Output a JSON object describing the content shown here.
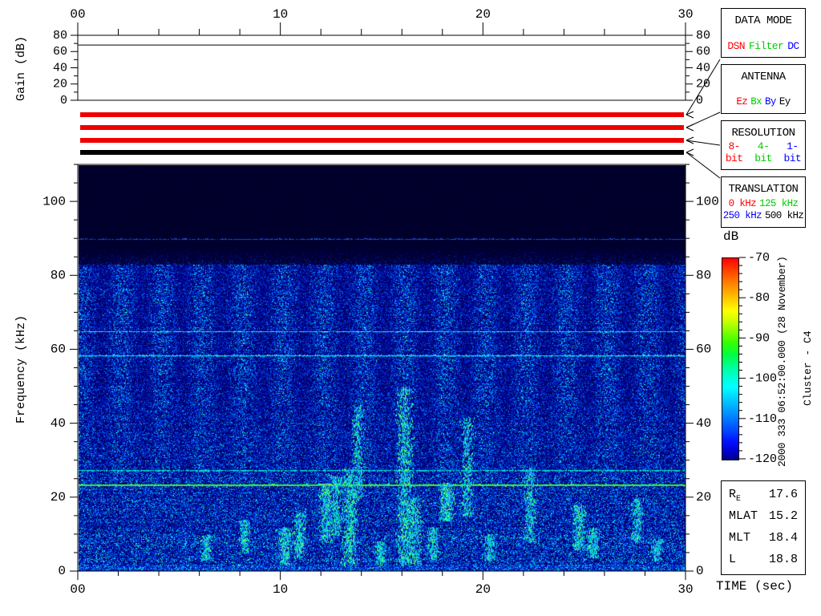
{
  "window": {
    "description": "Cluster C4 WBD plasma wave spectrogram display"
  },
  "gain_panel": {
    "ylabel": "Gain (dB)",
    "yticks": [
      "0",
      "20",
      "40",
      "60",
      "80"
    ],
    "xticks": [
      "00",
      "10",
      "20",
      "30"
    ],
    "gain_line_db": 68
  },
  "spectrogram": {
    "ylabel": "Frequency (kHz)",
    "xlabel": "TIME (sec)",
    "yticks": [
      "0",
      "20",
      "40",
      "60",
      "80",
      "100"
    ],
    "xticks": [
      "00",
      "10",
      "20",
      "30"
    ]
  },
  "colorbar": {
    "label": "dB",
    "ticks": [
      "-70",
      "-80",
      "-90",
      "-100",
      "-110",
      "-120"
    ]
  },
  "status_bars": [
    {
      "name": "data-mode-bar",
      "value": "DSN",
      "color": "#ee0000"
    },
    {
      "name": "antenna-bar",
      "value": "Ez",
      "color": "#ee0000"
    },
    {
      "name": "resolution-bar",
      "value": "8-bit",
      "color": "#ee0000"
    },
    {
      "name": "translation-bar",
      "value": "500 kHz",
      "color": "#000000"
    }
  ],
  "legend_boxes": [
    {
      "id": "data-mode",
      "title": "DATA MODE",
      "rows": [
        [
          {
            "label": "DSN",
            "color": "#ff0000"
          },
          {
            "label": "Filter",
            "color": "#00cc00"
          },
          {
            "label": "DC",
            "color": "#0000ff"
          }
        ]
      ]
    },
    {
      "id": "antenna",
      "title": "ANTENNA",
      "rows": [
        [
          {
            "label": "Ez",
            "color": "#ff0000"
          },
          {
            "label": "Bx",
            "color": "#00cc00"
          },
          {
            "label": "By",
            "color": "#0000ff"
          },
          {
            "label": "Ey",
            "color": "#000000"
          }
        ]
      ]
    },
    {
      "id": "resolution",
      "title": "RESOLUTION",
      "rows": [
        [
          {
            "label": "8-bit",
            "color": "#ff0000"
          },
          {
            "label": "4-bit",
            "color": "#00cc00"
          },
          {
            "label": "1-bit",
            "color": "#0000ff"
          }
        ]
      ]
    },
    {
      "id": "translation",
      "title": "TRANSLATION",
      "rows": [
        [
          {
            "label": "0 kHz",
            "color": "#ff0000"
          },
          {
            "label": "125 kHz",
            "color": "#00cc00"
          }
        ],
        [
          {
            "label": "250 kHz",
            "color": "#0000ff"
          },
          {
            "label": "500 kHz",
            "color": "#000000"
          }
        ]
      ]
    }
  ],
  "side_text": {
    "datetime": "2000 333 06:52:00.000 (28 November)",
    "spacecraft": "Cluster - C4"
  },
  "ephemeris": {
    "rows": [
      {
        "label": "R",
        "sub": "E",
        "value": "17.6"
      },
      {
        "label": "MLAT",
        "sub": "",
        "value": "15.2"
      },
      {
        "label": "MLT",
        "sub": "",
        "value": "18.4"
      },
      {
        "label": "L",
        "sub": "",
        "value": "18.8"
      }
    ]
  },
  "chart_data": [
    {
      "type": "line",
      "title": "Receiver gain vs time",
      "ylabel": "Gain (dB)",
      "xlim_sec": [
        0,
        30
      ],
      "ylim_db": [
        0,
        80
      ],
      "x_major_tick_step_sec": 10,
      "x_minor_tick_step_sec": 2,
      "series": [
        {
          "name": "gain_db",
          "x": [
            0,
            30
          ],
          "values": [
            68,
            68
          ]
        }
      ]
    },
    {
      "type": "heatmap",
      "title": "WBD electric field spectrogram",
      "xlabel": "TIME (sec)",
      "ylabel": "Frequency (kHz)",
      "xlim_sec": [
        0,
        30
      ],
      "ylim_khz": [
        0,
        110
      ],
      "color_scale": {
        "label": "dB",
        "min": -120,
        "max": -70,
        "ticks": [
          -70,
          -80,
          -90,
          -100,
          -110,
          -120
        ]
      },
      "noise_ceiling_khz": 83,
      "vertical_banding_period_sec": 2,
      "horizontal_lines_khz": [
        {
          "freq_khz": 90,
          "appearance": "faint dashed blue",
          "approx_db": -110
        },
        {
          "freq_khz": 65,
          "appearance": "thin cyan",
          "approx_db": -106
        },
        {
          "freq_khz": 58.5,
          "appearance": "cyan",
          "approx_db": -104
        },
        {
          "freq_khz": 27.5,
          "appearance": "cyan dashed",
          "approx_db": -104
        },
        {
          "freq_khz": 23.5,
          "appearance": "bright green solid",
          "approx_db": -95
        }
      ],
      "bursts": [
        {
          "t_sec": 6.3,
          "f_khz": [
            3,
            10
          ],
          "strength": 0.35
        },
        {
          "t_sec": 8.2,
          "f_khz": [
            5,
            14
          ],
          "strength": 0.4
        },
        {
          "t_sec": 10.2,
          "f_khz": [
            2,
            12
          ],
          "strength": 0.55
        },
        {
          "t_sec": 10.9,
          "f_khz": [
            4,
            16
          ],
          "strength": 0.5
        },
        {
          "t_sec": 12.2,
          "f_khz": [
            8,
            24
          ],
          "strength": 0.6
        },
        {
          "t_sec": 12.7,
          "f_khz": [
            10,
            26
          ],
          "strength": 0.55
        },
        {
          "t_sec": 13.4,
          "f_khz": [
            2,
            28
          ],
          "strength": 0.8
        },
        {
          "t_sec": 13.8,
          "f_khz": [
            20,
            45
          ],
          "strength": 0.45
        },
        {
          "t_sec": 14.9,
          "f_khz": [
            2,
            8
          ],
          "strength": 0.4
        },
        {
          "t_sec": 16.1,
          "f_khz": [
            2,
            50
          ],
          "strength": 0.85
        },
        {
          "t_sec": 16.6,
          "f_khz": [
            2,
            20
          ],
          "strength": 0.6
        },
        {
          "t_sec": 17.5,
          "f_khz": [
            3,
            12
          ],
          "strength": 0.45
        },
        {
          "t_sec": 18.2,
          "f_khz": [
            14,
            24
          ],
          "strength": 0.7
        },
        {
          "t_sec": 19.2,
          "f_khz": [
            15,
            42
          ],
          "strength": 0.5
        },
        {
          "t_sec": 20.3,
          "f_khz": [
            3,
            10
          ],
          "strength": 0.35
        },
        {
          "t_sec": 22.3,
          "f_khz": [
            8,
            28
          ],
          "strength": 0.5
        },
        {
          "t_sec": 24.7,
          "f_khz": [
            6,
            18
          ],
          "strength": 0.55
        },
        {
          "t_sec": 25.4,
          "f_khz": [
            4,
            12
          ],
          "strength": 0.45
        },
        {
          "t_sec": 27.6,
          "f_khz": [
            8,
            20
          ],
          "strength": 0.4
        },
        {
          "t_sec": 28.6,
          "f_khz": [
            3,
            9
          ],
          "strength": 0.35
        }
      ]
    }
  ]
}
